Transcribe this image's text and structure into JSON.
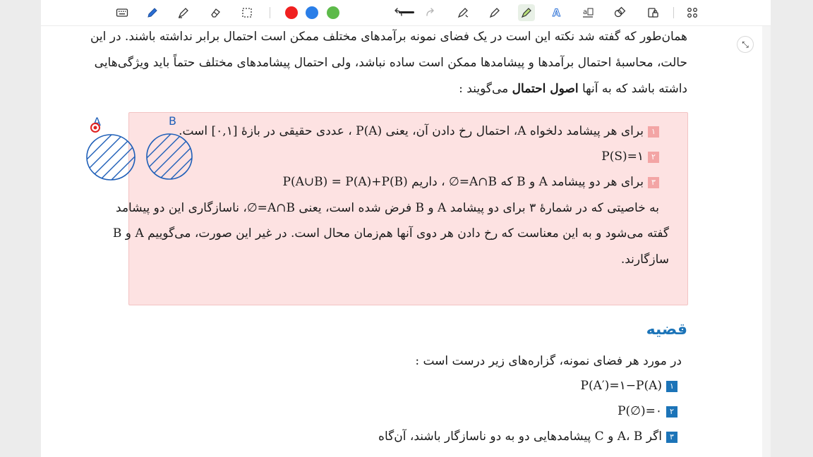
{
  "toolbar": {
    "tools": [
      "keyboard-icon",
      "pen-icon",
      "highlighter-icon",
      "eraser-icon",
      "lasso-icon",
      "color-red",
      "color-blue",
      "color-green",
      "stroke-width-icon",
      "undo-icon",
      "redo-icon",
      "magic-pen-icon",
      "shape-pen-icon",
      "marker-icon",
      "text-style-icon",
      "text-box-icon",
      "shapes-icon",
      "lock-icon",
      "grid-icon"
    ],
    "colors": {
      "red": "#f02020",
      "blue": "#2a7ee8",
      "green": "#5dba4a"
    }
  },
  "content": {
    "intro_line1": "همان‌طور که گفته شد نکته این است در یک فضای نمونه برآمدهای مختلف ممکن است احتمال برابر نداشته باشند. در این",
    "intro_line2": "حالت، محاسبهٔ احتمال برآمدها و پیشامدها ممکن است ساده نباشد، ولی احتمال پیشامدهای مختلف حتماً باید ویژگی‌هایی",
    "intro_line3_a": "داشته باشد که به آنها ",
    "intro_line3_bold": "اصول احتمال",
    "intro_line3_b": " می‌گویند :",
    "axiom1_num": "۱",
    "axiom1_text": "برای هر پیشامد دلخواه A، احتمال رخ دادن آن، یعنی P(A) ، عددی حقیقی در بازهٔ [۰,۱] است.",
    "axiom2_num": "۲",
    "axiom2_text": "P(S)=۱",
    "axiom3_num": "۳",
    "axiom3_text": "برای هر دو پیشامد A و B که A∩B=∅ ، داریم",
    "axiom3_formula": "P(A∪B) = P(A)+P(B)",
    "note_line1": "به خاصیتی که در شمارهٔ ۳ برای دو پیشامد A و B فرض شده است، یعنی A∩B=∅، ناسازگاری این دو پیشامد",
    "note_line2": "گفته می‌شود و به این معناست که رخ دادن هر دوی آنها هم‌زمان محال است. در غیر این صورت، می‌گوییم A و B",
    "note_line3": "سازگارند.",
    "heading": "قضیه",
    "theorem_intro": "در مورد هر فضای نمونه، گزاره‌های زیر درست است :",
    "t1_num": "۱",
    "t1": "P(A′)=۱−P(A)",
    "t2_num": "۲",
    "t2": "P(∅)=۰",
    "t3_num": "۳",
    "t3": "اگر A، B و C پیشامدهایی دو به دو ناسازگار باشند، آن‌گاه"
  },
  "sketch": {
    "label_a": "A",
    "label_b": "B"
  }
}
